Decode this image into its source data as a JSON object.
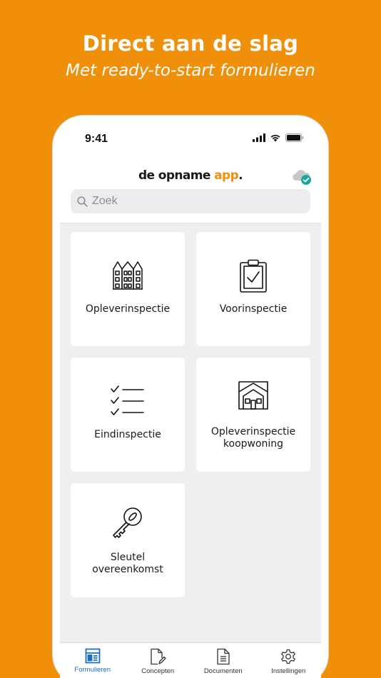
{
  "promo": {
    "title": "Direct aan de slag",
    "subtitle": "Met ready-to-start formulieren"
  },
  "status_bar": {
    "time": "9:41"
  },
  "header": {
    "logo_main": "de opname ",
    "logo_accent": "app",
    "logo_dot": "."
  },
  "search": {
    "placeholder": "Zoek"
  },
  "forms": [
    {
      "label": "Opleverinspectie",
      "icon": "buildings-icon"
    },
    {
      "label": "Voorinspectie",
      "icon": "clipboard-check-icon"
    },
    {
      "label": "Eindinspectie",
      "icon": "checklist-icon"
    },
    {
      "label": "Opleverinspectie koopwoning",
      "label_line1": "Opleverinspectie",
      "label_line2": "koopwoning",
      "icon": "house-icon"
    },
    {
      "label": "Sleutel overeenkomst",
      "label_line1": "Sleutel",
      "label_line2": "overeenkomst",
      "icon": "key-icon"
    }
  ],
  "tabs": [
    {
      "label": "Formulieren",
      "icon": "forms-icon",
      "active": true
    },
    {
      "label": "Concepten",
      "icon": "document-edit-icon",
      "active": false
    },
    {
      "label": "Documenten",
      "icon": "document-icon",
      "active": false
    },
    {
      "label": "Instellingen",
      "icon": "gear-icon",
      "active": false
    }
  ],
  "colors": {
    "background": "#F0900A",
    "accent": "#F0900A",
    "tab_active": "#1D6FC2",
    "sync_badge": "#1AA89A"
  }
}
